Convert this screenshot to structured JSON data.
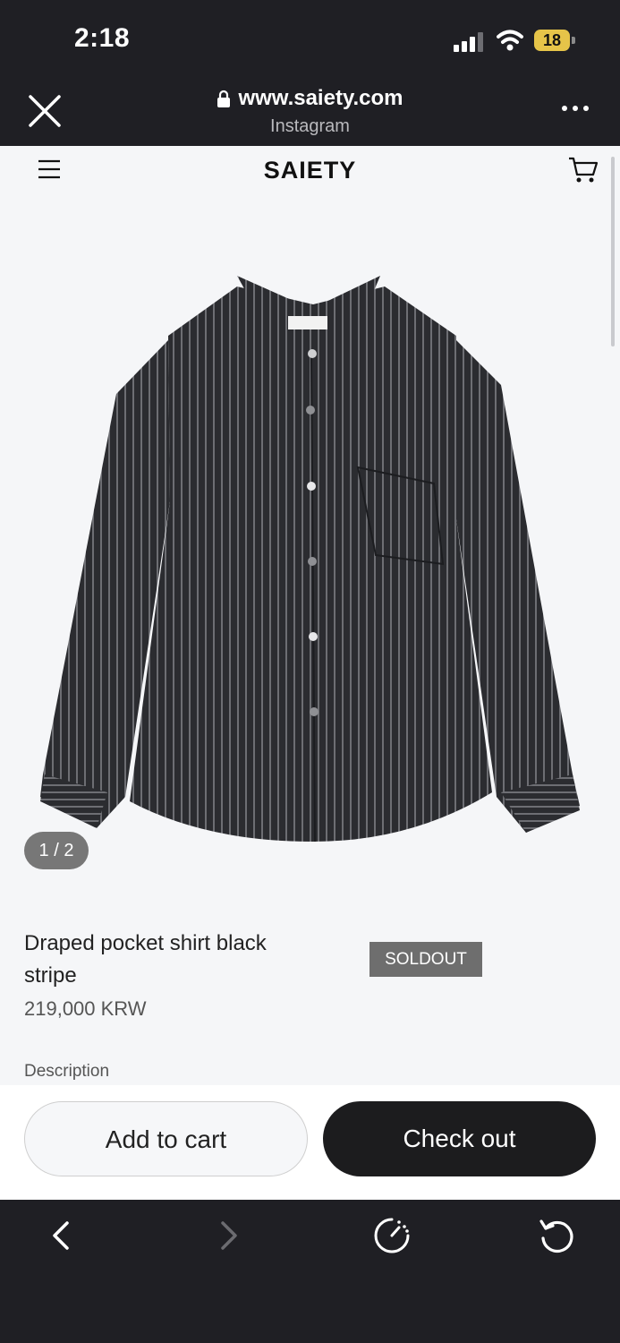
{
  "status_bar": {
    "time": "2:18",
    "battery_level": "18",
    "icons": [
      "cellular-signal-icon",
      "wifi-icon",
      "battery-charging-icon"
    ]
  },
  "browser": {
    "url": "www.saiety.com",
    "source_label": "Instagram",
    "icons": [
      "close-icon",
      "lock-icon",
      "more-icon"
    ]
  },
  "site": {
    "brand": "SAIETY",
    "icons": [
      "menu-icon",
      "cart-icon"
    ]
  },
  "product": {
    "image_counter": "1 / 2",
    "title": "Draped pocket shirt black stripe",
    "price": "219,000 KRW",
    "status_badge": "SOLDOUT",
    "description_label": "Description"
  },
  "actions": {
    "add_to_cart": "Add to cart",
    "checkout": "Check out"
  },
  "toolbar": {
    "icons": [
      "back-icon",
      "forward-icon",
      "speed-icon",
      "reload-icon"
    ]
  },
  "colors": {
    "chrome": "#1f1f24",
    "page_bg": "#f5f6f8",
    "badge_bg": "#6e6e6e",
    "checkout_bg": "#1c1c1e",
    "battery": "#e6c449"
  }
}
